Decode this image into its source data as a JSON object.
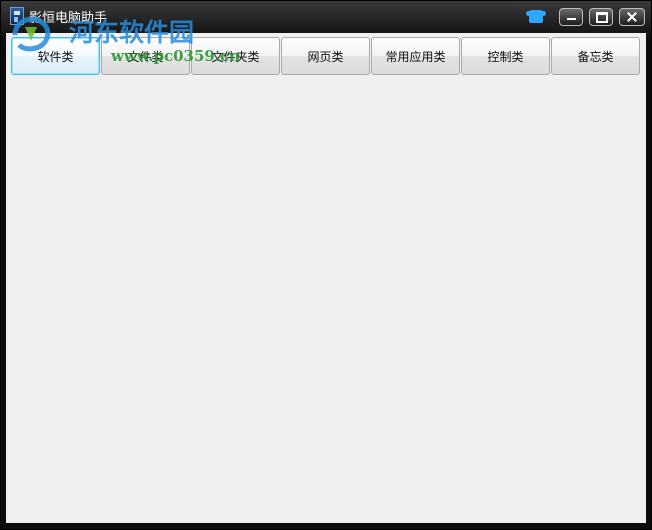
{
  "window": {
    "title": "影恒电脑助手"
  },
  "watermark": {
    "site_name_cn": "河东软件园",
    "site_url": "www.pc0359.cn"
  },
  "titlebar_buttons": {
    "skin_icon": "skin-shirt-icon",
    "minimize_icon": "minimize-icon",
    "maximize_icon": "maximize-icon",
    "close_icon": "close-icon"
  },
  "tabs": [
    {
      "label": "软件类",
      "active": true
    },
    {
      "label": "文件类",
      "active": false
    },
    {
      "label": "文件夹类",
      "active": false
    },
    {
      "label": "网页类",
      "active": false
    },
    {
      "label": "常用应用类",
      "active": false
    },
    {
      "label": "控制类",
      "active": false
    },
    {
      "label": "备忘类",
      "active": false
    }
  ],
  "colors": {
    "title_bar": "#0c0c0c",
    "client_bg": "#f0f0f0",
    "active_tab_border": "#3cbcf0",
    "watermark_blue": "#288cdc",
    "watermark_green": "#289632"
  }
}
